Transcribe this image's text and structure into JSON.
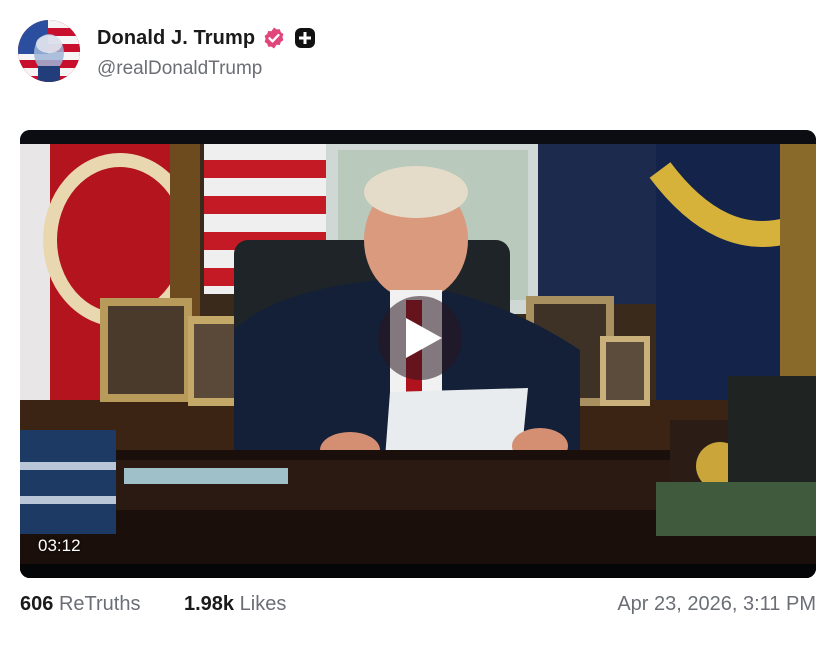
{
  "author": {
    "display_name": "Donald J. Trump",
    "handle": "@realDonaldTrump",
    "verified_icon": "verified-badge-icon",
    "plus_icon": "plus-badge-icon",
    "verified_color": "#e0457b"
  },
  "video": {
    "duration": "03:12",
    "play_icon": "play-icon"
  },
  "stats": {
    "retruths_count": "606",
    "retruths_label": "ReTruths",
    "likes_count": "1.98k",
    "likes_label": "Likes",
    "timestamp": "Apr 23, 2026, 3:11 PM"
  }
}
